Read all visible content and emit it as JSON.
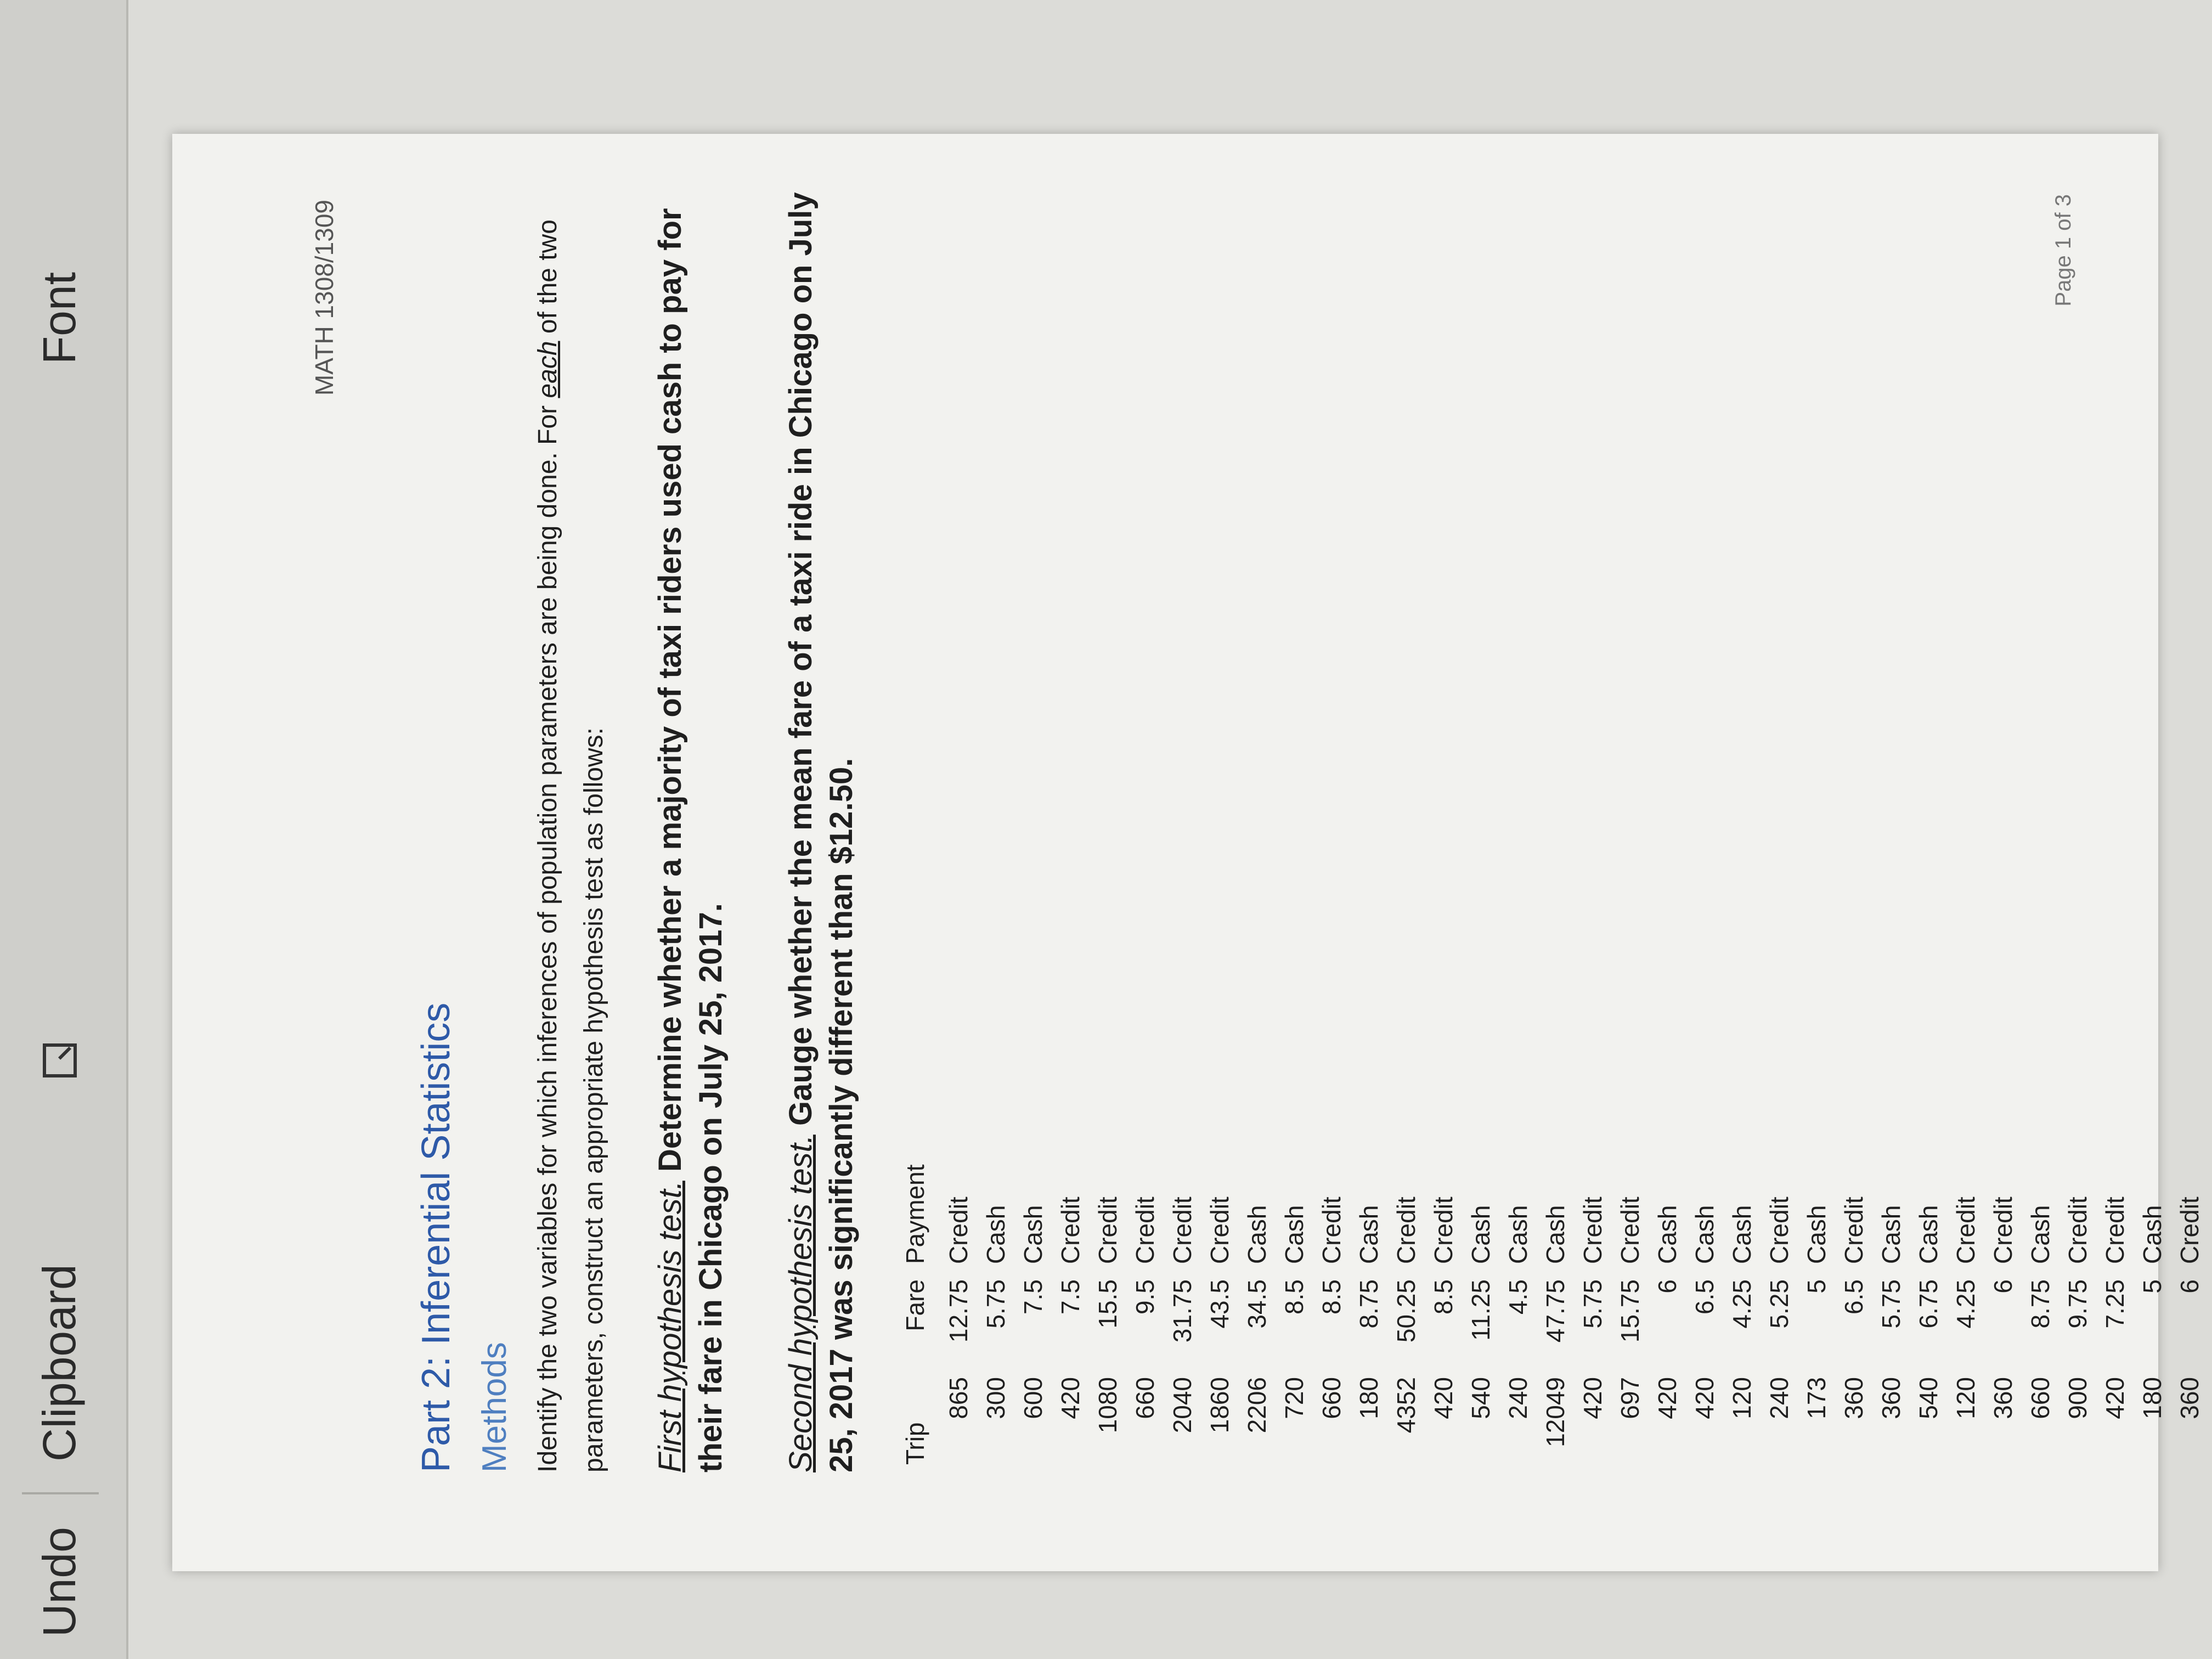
{
  "ribbon": {
    "undo_label": "Undo",
    "clipboard_label": "Clipboard",
    "font_label": "Font",
    "clipboard_launcher_icon": "dialog-launcher-icon"
  },
  "header": {
    "course": "MATH 1308/1309"
  },
  "document": {
    "part_title": "Part 2: Inferential Statistics",
    "methods_heading": "Methods",
    "intro_line1_pre": "Identify the two variables for which inferences of population parameters are being done. For ",
    "intro_line1_each": "each",
    "intro_line1_post": " of the two",
    "intro_line2": "parameters, construct an appropriate hypothesis test as follows:",
    "first_test_label": "First hypothesis test.",
    "first_test_text": " Determine whether a majority of taxi riders used cash to pay for their fare in Chicago on July 25, 2017.",
    "second_test_label": "Second hypothesis test.",
    "second_test_text": " Gauge whether the mean fare of a taxi ride in Chicago on July 25, 2017 was significantly different than $12.50."
  },
  "table": {
    "headers": [
      "Trip",
      "Fare",
      "Payment"
    ],
    "rows": [
      [
        "865",
        "12.75",
        "Credit"
      ],
      [
        "300",
        "5.75",
        "Cash"
      ],
      [
        "600",
        "7.5",
        "Cash"
      ],
      [
        "420",
        "7.5",
        "Credit"
      ],
      [
        "1080",
        "15.5",
        "Credit"
      ],
      [
        "660",
        "9.5",
        "Credit"
      ],
      [
        "2040",
        "31.75",
        "Credit"
      ],
      [
        "1860",
        "43.5",
        "Credit"
      ],
      [
        "2206",
        "34.5",
        "Cash"
      ],
      [
        "720",
        "8.5",
        "Cash"
      ],
      [
        "660",
        "8.5",
        "Credit"
      ],
      [
        "180",
        "8.75",
        "Cash"
      ],
      [
        "4352",
        "50.25",
        "Credit"
      ],
      [
        "420",
        "8.5",
        "Credit"
      ],
      [
        "540",
        "11.25",
        "Cash"
      ],
      [
        "240",
        "4.5",
        "Cash"
      ],
      [
        "12049",
        "47.75",
        "Cash"
      ],
      [
        "420",
        "5.75",
        "Credit"
      ],
      [
        "697",
        "15.75",
        "Credit"
      ],
      [
        "420",
        "6",
        "Cash"
      ],
      [
        "420",
        "6.5",
        "Cash"
      ],
      [
        "120",
        "4.25",
        "Cash"
      ],
      [
        "240",
        "5.25",
        "Credit"
      ],
      [
        "173",
        "5",
        "Cash"
      ],
      [
        "360",
        "6.5",
        "Credit"
      ],
      [
        "360",
        "5.75",
        "Cash"
      ],
      [
        "540",
        "6.75",
        "Cash"
      ],
      [
        "120",
        "4.25",
        "Credit"
      ],
      [
        "360",
        "6",
        "Credit"
      ],
      [
        "660",
        "8.75",
        "Cash"
      ],
      [
        "900",
        "9.75",
        "Credit"
      ],
      [
        "420",
        "7.25",
        "Credit"
      ],
      [
        "180",
        "5",
        "Cash"
      ],
      [
        "360",
        "6",
        "Credit"
      ]
    ]
  },
  "footer": {
    "page_label": "Page 1 of 3"
  }
}
